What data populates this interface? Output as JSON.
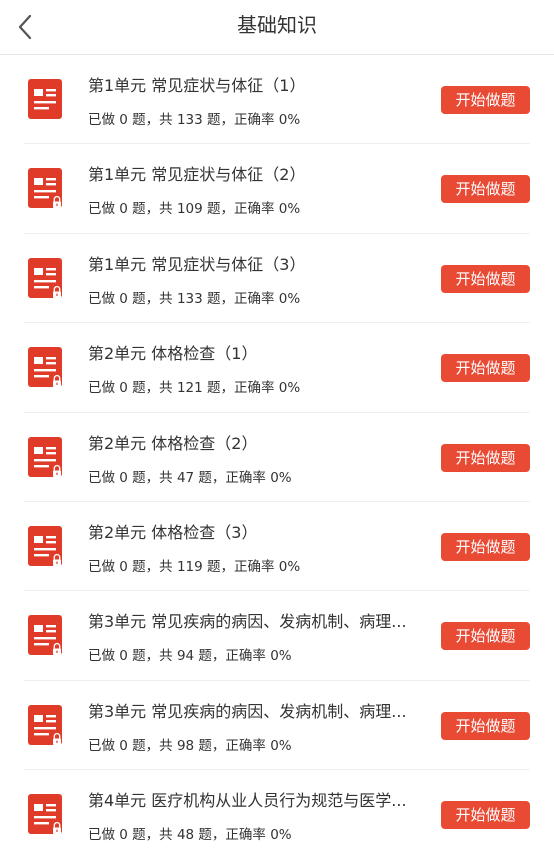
{
  "header": {
    "title": "基础知识",
    "back_icon": "chevron-left-icon"
  },
  "colors": {
    "accent": "#e84a34",
    "icon": "#e03a28",
    "text": "#333333",
    "divider": "#efefef"
  },
  "icon_names": {
    "row_icon": "document-lock-icon"
  },
  "items": [
    {
      "title": "第1单元 常见症状与体征（1）",
      "stats": "已做 0 题，共 133 题，正确率 0%",
      "button": "开始做题",
      "locked": false
    },
    {
      "title": "第1单元 常见症状与体征（2）",
      "stats": "已做 0 题，共 109 题，正确率 0%",
      "button": "开始做题",
      "locked": true
    },
    {
      "title": "第1单元 常见症状与体征（3）",
      "stats": "已做 0 题，共 133 题，正确率 0%",
      "button": "开始做题",
      "locked": true
    },
    {
      "title": "第2单元 体格检查（1）",
      "stats": "已做 0 题，共 121 题，正确率 0%",
      "button": "开始做题",
      "locked": true
    },
    {
      "title": "第2单元 体格检查（2）",
      "stats": "已做 0 题，共 47 题，正确率 0%",
      "button": "开始做题",
      "locked": true
    },
    {
      "title": "第2单元 体格检查（3）",
      "stats": "已做 0 题，共 119 题，正确率 0%",
      "button": "开始做题",
      "locked": true
    },
    {
      "title": "第3单元 常见疾病的病因、发病机制、病理...",
      "stats": "已做 0 题，共 94 题，正确率 0%",
      "button": "开始做题",
      "locked": true
    },
    {
      "title": "第3单元 常见疾病的病因、发病机制、病理...",
      "stats": "已做 0 题，共 98 题，正确率 0%",
      "button": "开始做题",
      "locked": true
    },
    {
      "title": "第4单元 医疗机构从业人员行为规范与医学...",
      "stats": "已做 0 题，共 48 题，正确率 0%",
      "button": "开始做题",
      "locked": true
    }
  ]
}
